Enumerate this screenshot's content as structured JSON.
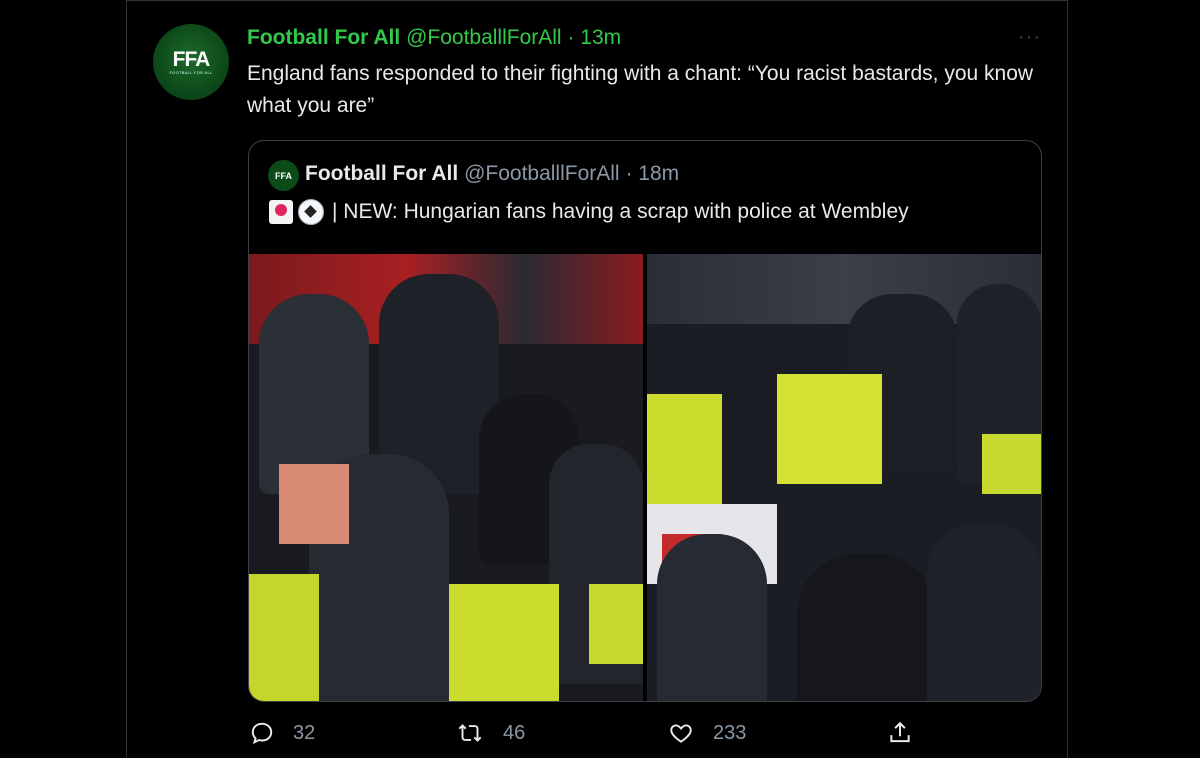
{
  "tweet": {
    "avatar_text": "FFA",
    "avatar_subtext": "FOOTBALL FOR ALL",
    "name": "Football For All",
    "handle": "@FootballlForAll",
    "separator": "·",
    "time": "13m",
    "text": "England fans responded to their fighting with a chant: “You racist bastards, you know what you are”",
    "more_icon": "more-dots-icon"
  },
  "quote": {
    "avatar_text": "FFA",
    "name": "Football For All",
    "handle": "@FootballlForAll",
    "separator": "·",
    "time": "18m",
    "text": "| NEW: Hungarian fans having a scrap with police at Wembley",
    "emojis": [
      "police-light-emoji",
      "soccer-ball-emoji"
    ],
    "photos": [
      "photo-fans-and-police-left",
      "photo-fans-and-police-right"
    ]
  },
  "actions": {
    "replies": "32",
    "retweets": "46",
    "likes": "233"
  },
  "colors": {
    "accent": "#33c94a",
    "background": "#000000",
    "secondary_text": "#8b98a5",
    "border": "#3e4144"
  }
}
